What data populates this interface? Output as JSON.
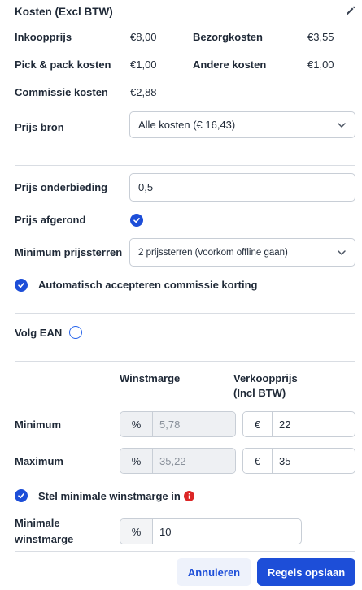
{
  "header": {
    "title": "Kosten (Excl BTW)",
    "edit_icon": "pencil-icon"
  },
  "costs": {
    "inkoopprijs": {
      "label": "Inkoopprijs",
      "value": "€8,00"
    },
    "bezorgkosten": {
      "label": "Bezorgkosten",
      "value": "€3,55"
    },
    "pick_pack": {
      "label": "Pick & pack kosten",
      "value": "€1,00"
    },
    "andere": {
      "label": "Andere kosten",
      "value": "€1,00"
    },
    "commissie": {
      "label": "Commissie kosten",
      "value": "€2,88"
    }
  },
  "prijs_bron": {
    "label": "Prijs bron",
    "value": "Alle kosten (€ 16,43)"
  },
  "prijs_onderbieding": {
    "label": "Prijs onderbieding",
    "value": "0,5"
  },
  "prijs_afgerond": {
    "label": "Prijs afgerond",
    "checked": true
  },
  "minimum_prijssterren": {
    "label": "Minimum prijssterren",
    "value": "2 prijssterren (voorkom offline gaan)"
  },
  "auto_accept": {
    "label": "Automatisch accepteren commissie korting",
    "checked": true
  },
  "volg_ean": {
    "label": "Volg EAN",
    "checked": false
  },
  "margins": {
    "col_winstmarge": "Winstmarge",
    "col_verkoopprijs_line1": "Verkoopprijs",
    "col_verkoopprijs_line2": "(Incl BTW)",
    "percent_symbol": "%",
    "euro_symbol": "€",
    "minimum": {
      "label": "Minimum",
      "winstmarge": "5,78",
      "verkoopprijs": "22"
    },
    "maximum": {
      "label": "Maximum",
      "winstmarge": "35,22",
      "verkoopprijs": "35"
    }
  },
  "stel_min": {
    "label": "Stel minimale winstmarge in",
    "checked": true,
    "info_icon": "info-icon"
  },
  "minimale_winstmarge": {
    "label_line1": "Minimale",
    "label_line2": "winstmarge",
    "value": "10"
  },
  "footer": {
    "cancel_label": "Annuleren",
    "save_label": "Regels opslaan"
  },
  "colors": {
    "primary": "#1d4ed8",
    "info_red": "#dc2626",
    "disabled_bg": "#eef0f3"
  }
}
